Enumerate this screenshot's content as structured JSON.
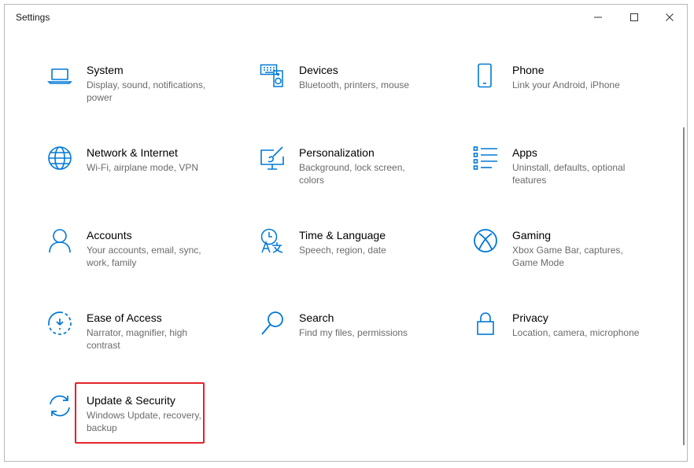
{
  "window": {
    "title": "Settings"
  },
  "controls": {
    "minimize": "minimize-icon",
    "maximize": "maximize-icon",
    "close": "close-icon"
  },
  "colors": {
    "accent": "#0078d7",
    "highlight": "#e3242b"
  },
  "tiles": [
    {
      "title": "System",
      "desc": "Display, sound, notifications, power",
      "icon": "laptop-icon"
    },
    {
      "title": "Devices",
      "desc": "Bluetooth, printers, mouse",
      "icon": "keyboard-speaker-icon"
    },
    {
      "title": "Phone",
      "desc": "Link your Android, iPhone",
      "icon": "phone-icon"
    },
    {
      "title": "Network & Internet",
      "desc": "Wi-Fi, airplane mode, VPN",
      "icon": "globe-icon"
    },
    {
      "title": "Personalization",
      "desc": "Background, lock screen, colors",
      "icon": "paint-monitor-icon"
    },
    {
      "title": "Apps",
      "desc": "Uninstall, defaults, optional features",
      "icon": "app-list-icon"
    },
    {
      "title": "Accounts",
      "desc": "Your accounts, email, sync, work, family",
      "icon": "person-icon"
    },
    {
      "title": "Time & Language",
      "desc": "Speech, region, date",
      "icon": "clock-language-icon"
    },
    {
      "title": "Gaming",
      "desc": "Xbox Game Bar, captures, Game Mode",
      "icon": "xbox-icon"
    },
    {
      "title": "Ease of Access",
      "desc": "Narrator, magnifier, high contrast",
      "icon": "ease-of-access-icon"
    },
    {
      "title": "Search",
      "desc": "Find my files, permissions",
      "icon": "search-icon"
    },
    {
      "title": "Privacy",
      "desc": "Location, camera, microphone",
      "icon": "lock-icon"
    },
    {
      "title": "Update & Security",
      "desc": "Windows Update, recovery, backup",
      "icon": "sync-arrows-icon"
    }
  ]
}
